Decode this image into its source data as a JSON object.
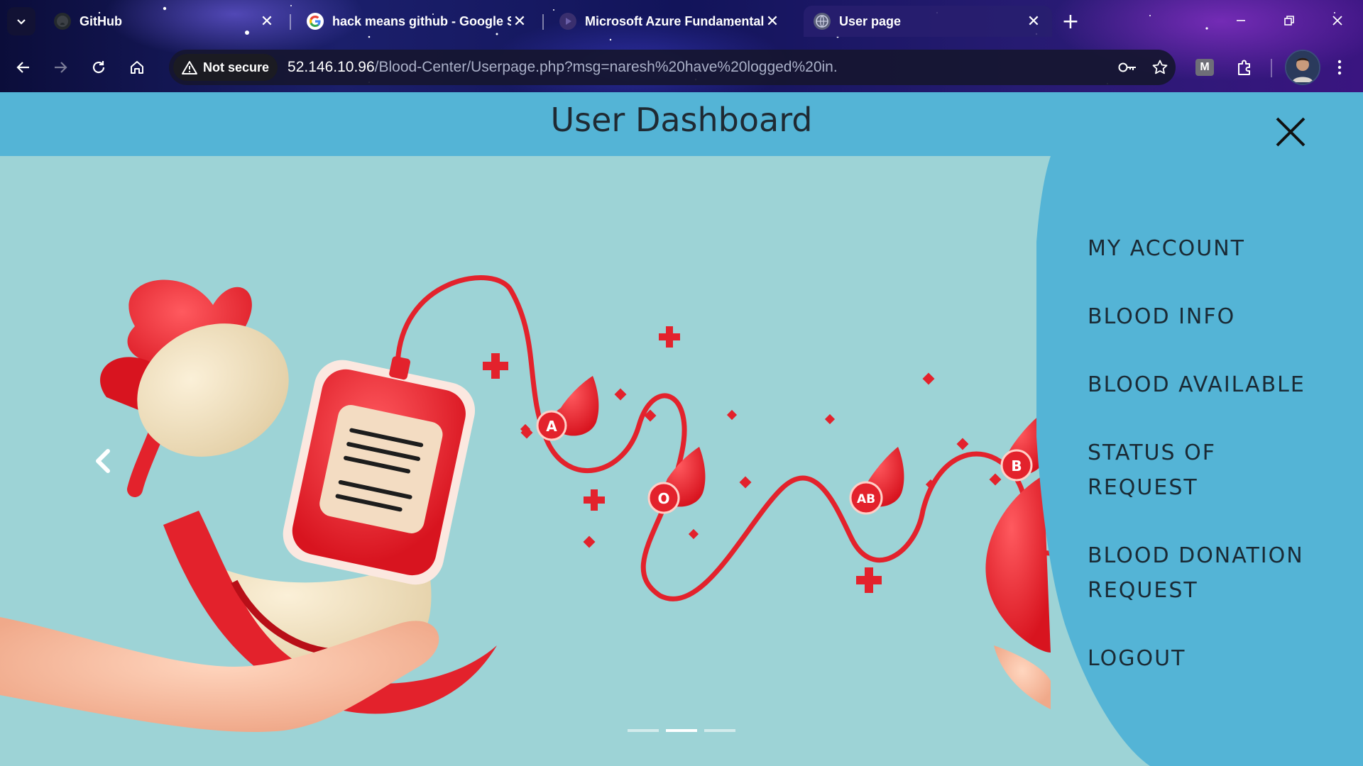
{
  "browser": {
    "tabs": [
      {
        "title": "GitHub",
        "favicon": "github-icon",
        "active": false
      },
      {
        "title": "hack means github - Google S",
        "favicon": "google-icon",
        "active": false
      },
      {
        "title": "Microsoft Azure Fundamentals",
        "favicon": "video-icon",
        "active": false
      },
      {
        "title": "User page",
        "favicon": "globe-icon",
        "active": true
      }
    ],
    "security_label": "Not secure",
    "url_host": "52.146.10.96",
    "url_path": "/Blood-Center/Userpage.php?msg=naresh%20have%20logged%20in.",
    "extension_m_label": "M"
  },
  "page": {
    "title": "User Dashboard",
    "menu": [
      "MY ACCOUNT",
      "BLOOD INFO",
      "BLOOD AVAILABLE",
      "STATUS OF REQUEST",
      "BLOOD DONATION REQUEST",
      "LOGOUT"
    ],
    "carousel": {
      "slide_count": 3,
      "active_index": 1
    },
    "hero_labels": {
      "a": "A",
      "o": "O",
      "ab": "AB",
      "b": "B"
    }
  },
  "colors": {
    "header_bg": "#54b4d6",
    "hero_bg": "#9dd3d6",
    "blood_red": "#e3222c",
    "menu_text": "#1a2a35"
  }
}
